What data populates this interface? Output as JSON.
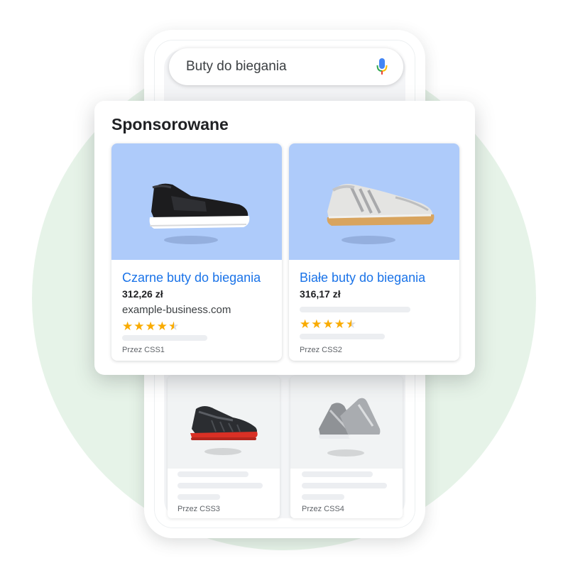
{
  "search": {
    "query": "Buty do biegania",
    "mic_icon": "mic-icon"
  },
  "sponsored": {
    "heading": "Sponsorowane",
    "products": [
      {
        "title": "Czarne buty do biegania",
        "price": "312,26 zł",
        "domain": "example-business.com",
        "stars": "★★★★",
        "half_star": "★",
        "rating": 4.5,
        "via": "Przez CSS1",
        "image": "black-running-shoe"
      },
      {
        "title": "Białe buty do biegania",
        "price": "316,17 zł",
        "stars": "★★★★",
        "half_star": "★",
        "rating": 4.5,
        "via": "Przez CSS2",
        "image": "white-running-shoe"
      }
    ]
  },
  "listing": {
    "products": [
      {
        "via": "Przez CSS3",
        "image": "dark-running-shoe-red-sole"
      },
      {
        "via": "Przez CSS4",
        "image": "grey-running-shoe-pair"
      }
    ]
  },
  "colors": {
    "accent_blue": "#1a73e8",
    "star": "#f9ab00",
    "card_image_bg": "#aecbfa",
    "background_circle": "#e6f3e8"
  }
}
